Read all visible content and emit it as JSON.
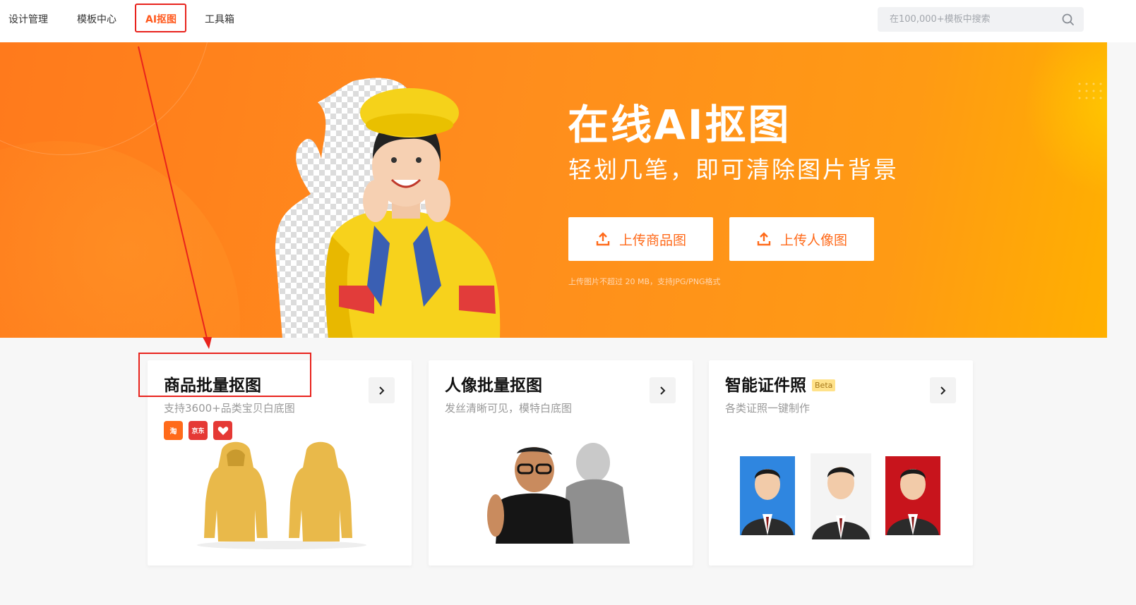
{
  "nav": {
    "items": [
      "设计管理",
      "模板中心",
      "AI抠图",
      "工具箱"
    ],
    "active_index": 2,
    "accent_color": "#ff5a1f"
  },
  "search": {
    "placeholder": "在100,000+模板中搜索",
    "icon": "search-icon"
  },
  "hero": {
    "title": "在线AI抠图",
    "subtitle": "轻划几笔，即可清除图片背景",
    "buttons": [
      {
        "label": "上传商品图",
        "icon": "upload-icon"
      },
      {
        "label": "上传人像图",
        "icon": "upload-icon"
      }
    ],
    "note": "上传图片不超过 20 MB，支持JPG/PNG格式",
    "gradient_start": "#ff7a1c",
    "gradient_end": "#ffb000",
    "badge_colors": [
      "#e23c3a",
      "#3a5fb3",
      "#fff"
    ]
  },
  "cards": [
    {
      "title": "商品批量抠图",
      "desc": "支持3600+品类宝贝白底图",
      "platforms": [
        {
          "name": "taobao",
          "label": "淘",
          "color": "#ff6a1a"
        },
        {
          "name": "jd",
          "label": "京东",
          "color": "#e53935"
        },
        {
          "name": "tmall-like",
          "label": "",
          "color": "#e53935"
        }
      ]
    },
    {
      "title": "人像批量抠图",
      "desc": "发丝清晰可见，模特白底图"
    },
    {
      "title": "智能证件照",
      "badge": "Beta",
      "desc": "各类证照一键制作",
      "photo_backgrounds": [
        "#2f86e0",
        "#f4f4f4",
        "#c8141c"
      ]
    }
  ],
  "annotation_color": "#e8231d"
}
